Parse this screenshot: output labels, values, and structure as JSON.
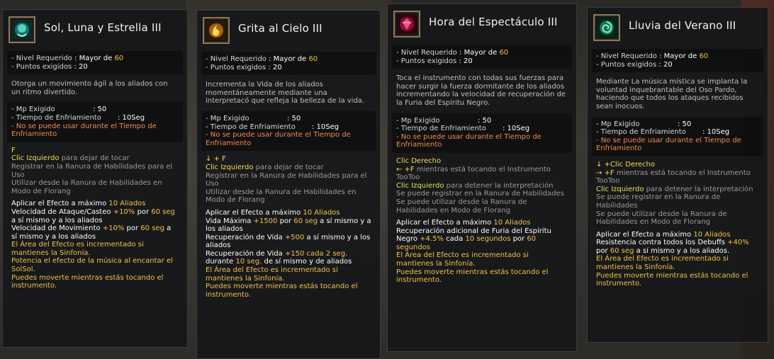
{
  "colors": {
    "highlight": "#f2c04a",
    "warning": "#f08a4a",
    "key": "#e8e05a",
    "hint": "#9a9a9a"
  },
  "labels": {
    "level": "- Nivel Requerido",
    "level_val": ": Mayor de",
    "points": "- Puntos exigidos",
    "points_val": ": 20",
    "mp": "- Mp Exigido",
    "mp_val": ": 50",
    "cd": "- Tiempo de Enfriamiento",
    "cd_val": ": 10Seg",
    "no_cd": "- No se puede usar durante el Tiempo de Enfriamiento"
  },
  "tooltips": [
    {
      "title": "Sol, Luna y Estrella III",
      "icon": "teal-spirit-icon",
      "level": "60",
      "desc": "Otorga un movimiento ágil a los aliados con un ritmo divertido.",
      "controls": [
        {
          "text": "F",
          "cls": "yellow"
        },
        {
          "parts": [
            {
              "t": "Clic Izquierdo",
              "c": "yellow"
            },
            {
              "t": " para dejar de tocar",
              "c": "grey"
            }
          ]
        },
        {
          "text": "Registrar en la Ranura de Habilidades para el Uso",
          "cls": "grey"
        },
        {
          "text": "Utilizar desde la Ranura de Habilidades en Modo de Florang",
          "cls": "grey"
        }
      ],
      "effects": [
        {
          "parts": [
            {
              "t": "Aplicar el Efecto a máximo ",
              "c": "val"
            },
            {
              "t": "10 Aliados",
              "c": "gold"
            }
          ]
        },
        {
          "parts": [
            {
              "t": "Velocidad de Ataque/Casteo ",
              "c": "val"
            },
            {
              "t": "+10%",
              "c": "gold"
            },
            {
              "t": " por ",
              "c": "val"
            },
            {
              "t": "60 seg",
              "c": "gold"
            },
            {
              "t": " a sí mismo y a los aliados",
              "c": "val"
            }
          ]
        },
        {
          "parts": [
            {
              "t": "Velocidad de Movimiento ",
              "c": "val"
            },
            {
              "t": "+10%",
              "c": "gold"
            },
            {
              "t": " por ",
              "c": "val"
            },
            {
              "t": "60 seg",
              "c": "gold"
            },
            {
              "t": " a sí mismo y a los aliados",
              "c": "val"
            }
          ]
        },
        {
          "parts": [
            {
              "t": "El Área del Efecto es incrementado si mantienes la Sinfonía.",
              "c": "gold"
            }
          ]
        },
        {
          "parts": [
            {
              "t": "Potencia el efecto de la música al encantar el SolSol.",
              "c": "gold"
            }
          ]
        },
        {
          "parts": [
            {
              "t": "Puedes moverte mientras estás tocando el instrumento.",
              "c": "gold"
            }
          ]
        }
      ]
    },
    {
      "title": "Grita al Cielo III",
      "icon": "golden-flame-icon",
      "level": "60",
      "desc": "Incrementa la Vida de los aliados momentáneamente mediante una interpretacó que refleja la belleza de la vida.",
      "controls": [
        {
          "text": "↓ + F",
          "cls": "yellow"
        },
        {
          "parts": [
            {
              "t": "Clic Izquierdo",
              "c": "yellow"
            },
            {
              "t": " para dejar de tocar",
              "c": "grey"
            }
          ]
        },
        {
          "text": "Registrar en la Ranura de Habilidades para el Uso",
          "cls": "grey"
        },
        {
          "text": "Utilizar desde la Ranura de Habilidades en Modo de Florang",
          "cls": "grey"
        }
      ],
      "effects": [
        {
          "parts": [
            {
              "t": "Aplicar el Efecto a máximo ",
              "c": "val"
            },
            {
              "t": "10 Aliados",
              "c": "gold"
            }
          ]
        },
        {
          "parts": [
            {
              "t": "Vida Máxima ",
              "c": "val"
            },
            {
              "t": "+1500",
              "c": "gold"
            },
            {
              "t": " por ",
              "c": "val"
            },
            {
              "t": "60 seg",
              "c": "gold"
            },
            {
              "t": " a sí mismo y a los aliados",
              "c": "val"
            }
          ]
        },
        {
          "parts": [
            {
              "t": "Recuperación de Vida ",
              "c": "val"
            },
            {
              "t": "+500",
              "c": "gold"
            },
            {
              "t": " a sí mismo y a los aliados",
              "c": "val"
            }
          ]
        },
        {
          "parts": [
            {
              "t": "Recuperación de Vida ",
              "c": "val"
            },
            {
              "t": "+150 cada 2 seg.",
              "c": "gold"
            },
            {
              "t": " durante ",
              "c": "val"
            },
            {
              "t": "10 seg.",
              "c": "gold"
            },
            {
              "t": " de sí mismo y de aliados",
              "c": "val"
            }
          ]
        },
        {
          "parts": [
            {
              "t": "El Área del Efecto es incrementado si mantienes la Sinfonía.",
              "c": "gold"
            }
          ]
        },
        {
          "parts": [
            {
              "t": "Puedes moverte mientras estás tocando el instrumento.",
              "c": "gold"
            }
          ]
        }
      ]
    },
    {
      "title": "Hora del Espectáculo III",
      "icon": "pink-gem-icon",
      "level": "60",
      "desc": "Toca el instrumento con todas sus fuerzas para hacer surgir la fuerza dormitante de los aliados incrementando la velocidad de recuperación de la Furia del Espíritu Negro.",
      "controls": [
        {
          "text": "Clic Derecho",
          "cls": "yellow"
        },
        {
          "parts": [
            {
              "t": "← +F",
              "c": "yellow"
            },
            {
              "t": " mientras está tocando el Instrumento TooToo",
              "c": "grey"
            }
          ]
        },
        {
          "parts": [
            {
              "t": "Clic Izquierdo",
              "c": "yellow"
            },
            {
              "t": "  para detener la interpretación",
              "c": "grey"
            }
          ]
        },
        {
          "text": "Se puede registrar en la Ranura de Habilidades",
          "cls": "grey"
        },
        {
          "text": "Se puede utilizar desde la Ranura de Habilidades en Modo de Florang",
          "cls": "grey"
        }
      ],
      "effects": [
        {
          "parts": [
            {
              "t": "Aplicar el Efecto a máximo ",
              "c": "val"
            },
            {
              "t": "10 Aliados",
              "c": "gold"
            }
          ]
        },
        {
          "parts": [
            {
              "t": "Recuperación adicional de Furia del Espíritu Negro ",
              "c": "val"
            },
            {
              "t": "+4.5%",
              "c": "gold"
            },
            {
              "t": " cada ",
              "c": "val"
            },
            {
              "t": "10 segundos",
              "c": "gold"
            },
            {
              "t": " por ",
              "c": "val"
            },
            {
              "t": "60 segundos",
              "c": "gold"
            }
          ]
        },
        {
          "parts": [
            {
              "t": "El Área del Efecto es incrementado si mantienes la Sinfonía.",
              "c": "gold"
            }
          ]
        },
        {
          "parts": [
            {
              "t": "Puedes moverte mientras estás tocando el instrumento.",
              "c": "gold"
            }
          ]
        }
      ]
    },
    {
      "title": "Lluvia del Verano III",
      "icon": "green-swirl-icon",
      "level": "60",
      "desc": "Mediante La música mística se implanta la voluntad inquebrantable del Oso Pardo, haciendo que todos los ataques recibidos sean inocuos.",
      "controls": [
        {
          "text": "↓ +Clic Derecho",
          "cls": "yellow"
        },
        {
          "parts": [
            {
              "t": "→ +F",
              "c": "yellow"
            },
            {
              "t": " mientras está tocando el Instrumento TooToo",
              "c": "grey"
            }
          ]
        },
        {
          "parts": [
            {
              "t": "Clic Izquierdo",
              "c": "yellow"
            },
            {
              "t": "  para detener la interpretación",
              "c": "grey"
            }
          ]
        },
        {
          "text": "Se puede registrar en la Ranura de Habilidades",
          "cls": "grey"
        },
        {
          "text": "Se puede utilizar desde la Ranura de Habilidades en Modo de Florang",
          "cls": "grey"
        }
      ],
      "effects": [
        {
          "parts": [
            {
              "t": "Aplicar el Efecto a máximo ",
              "c": "val"
            },
            {
              "t": "10 Aliados",
              "c": "gold"
            }
          ]
        },
        {
          "parts": [
            {
              "t": "Resistencia contra todos los Debuffs ",
              "c": "val"
            },
            {
              "t": "+40%",
              "c": "gold"
            },
            {
              "t": " por ",
              "c": "val"
            },
            {
              "t": "60 seg",
              "c": "gold"
            },
            {
              "t": " a sí mismo y a los aliados.",
              "c": "val"
            }
          ]
        },
        {
          "parts": [
            {
              "t": "El Área del Efecto es incrementado si mantienes la Sinfonía.",
              "c": "gold"
            }
          ]
        },
        {
          "parts": [
            {
              "t": "Puedes moverte mientras estás tocando el instrumento.",
              "c": "gold"
            }
          ]
        }
      ]
    }
  ]
}
